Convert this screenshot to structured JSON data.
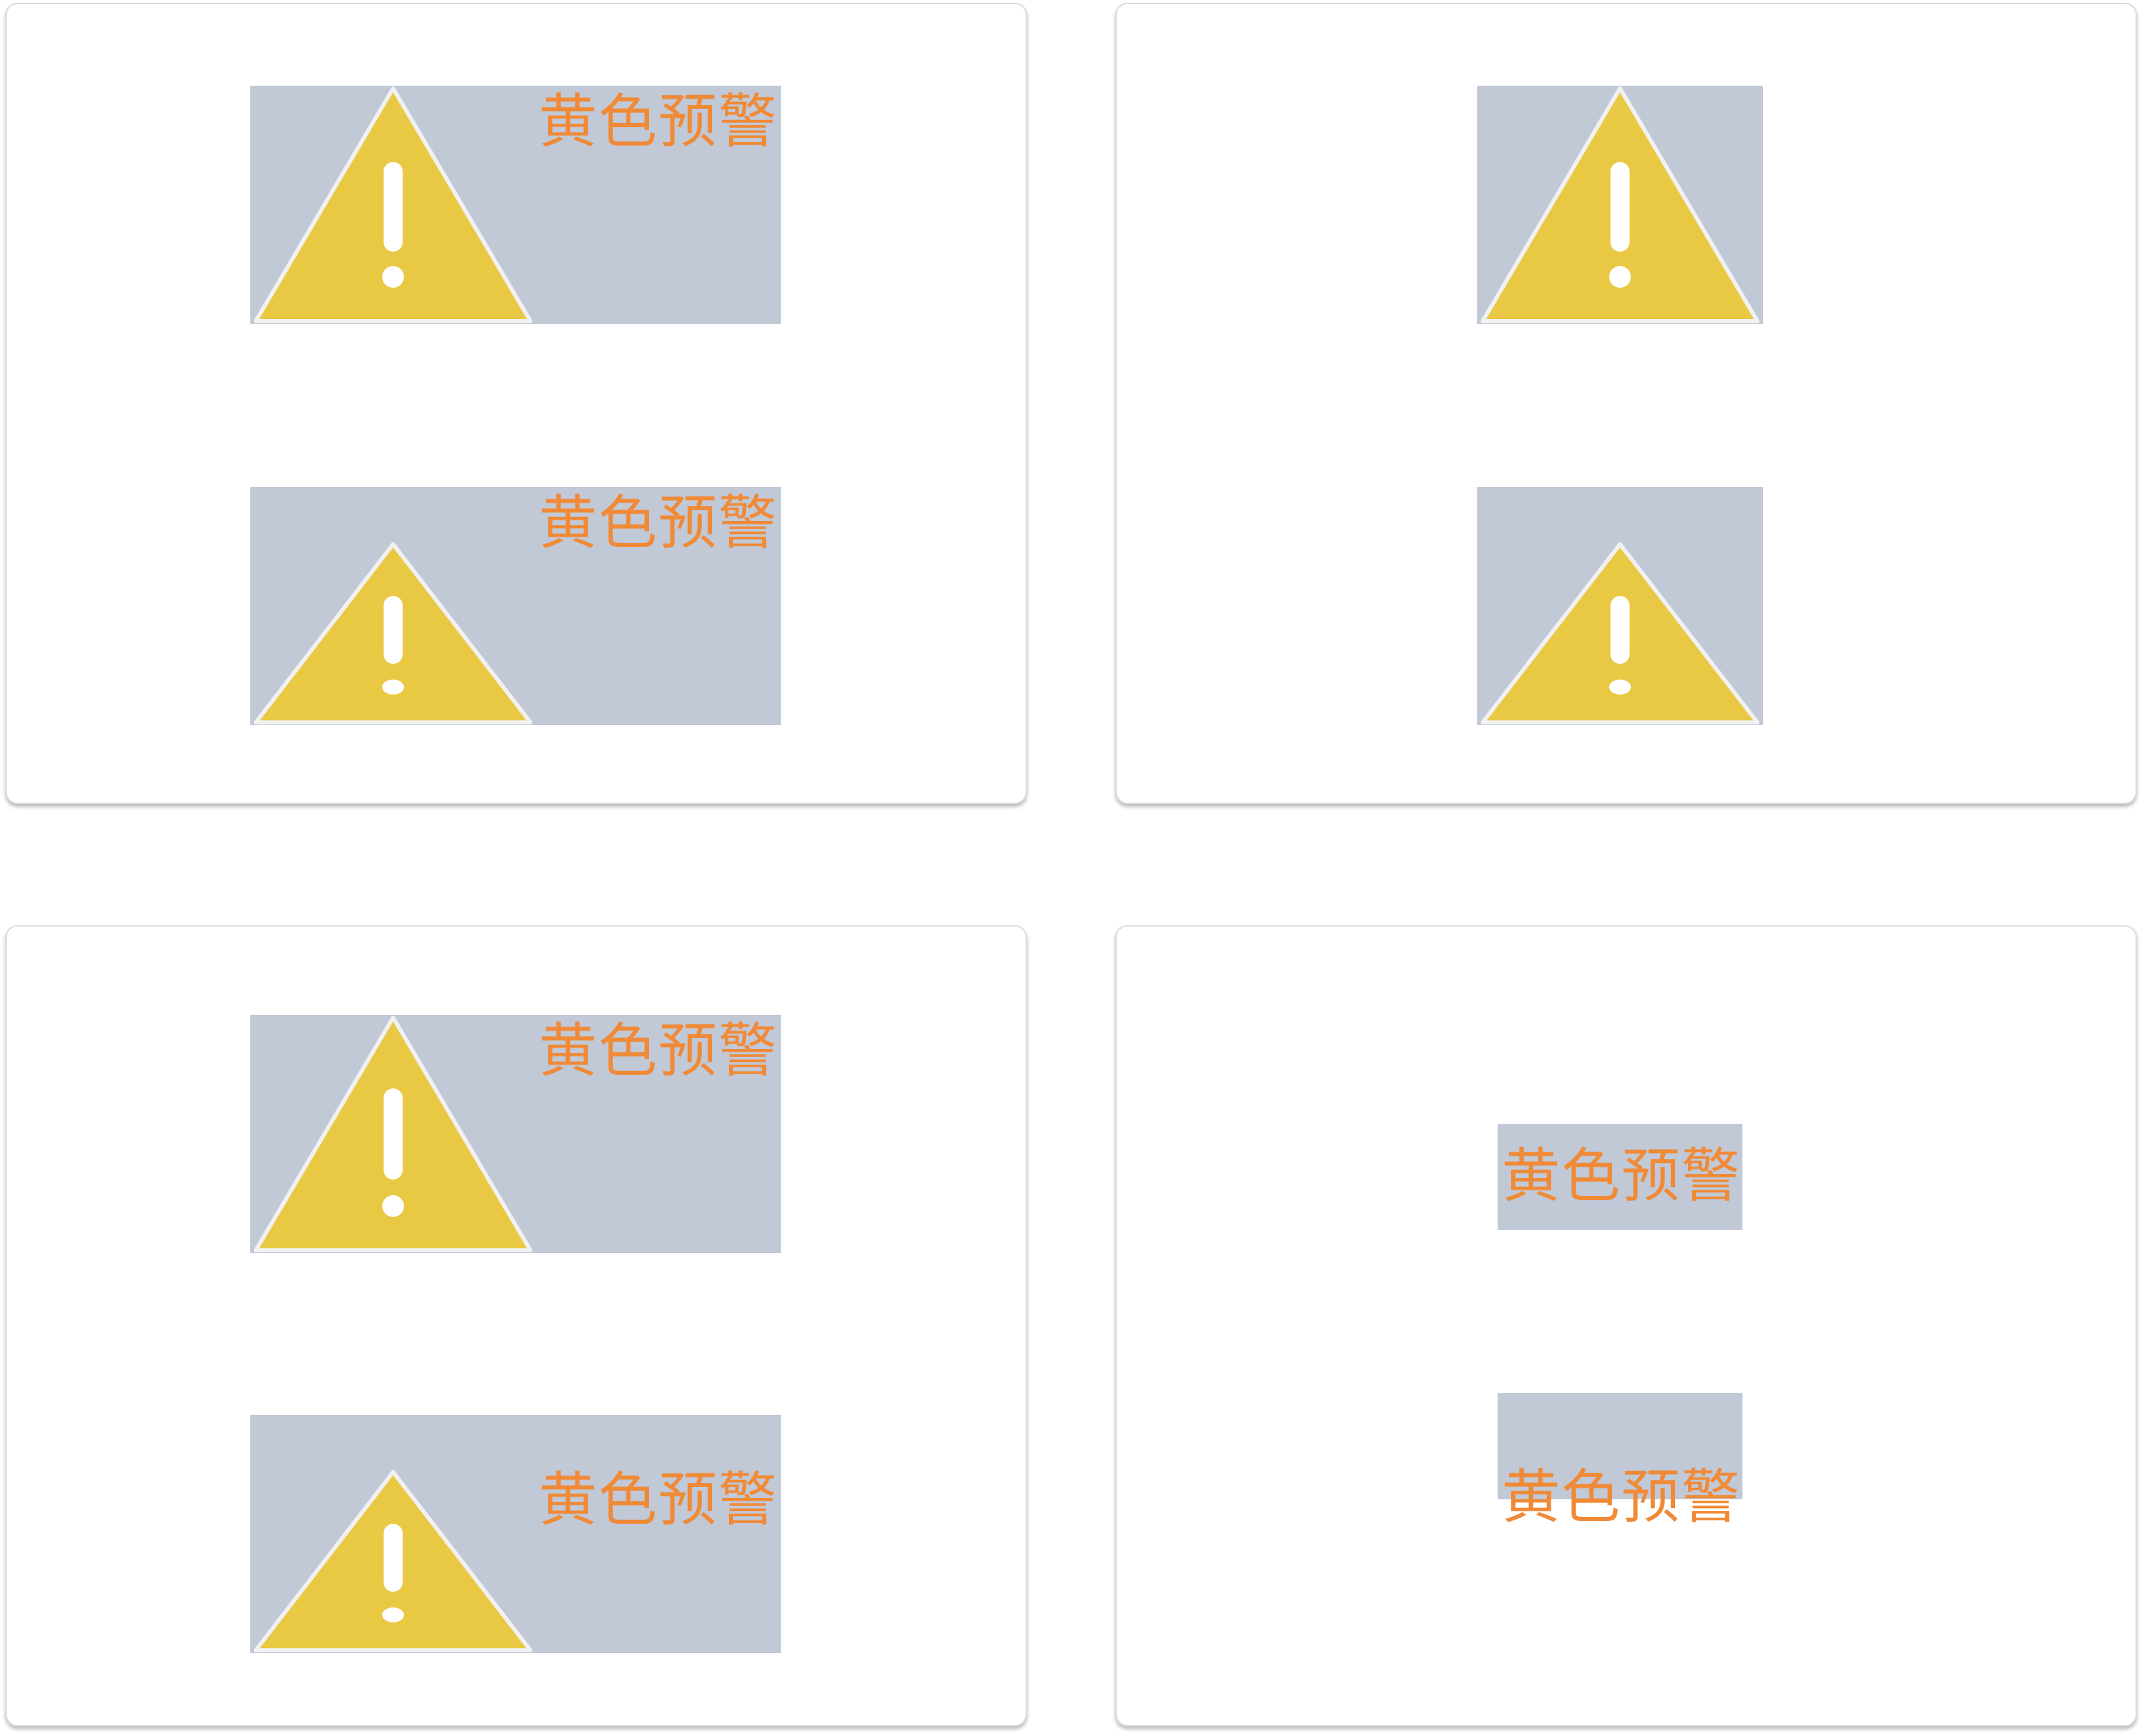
{
  "widgets": {
    "top_left": {
      "label_1": "黄色预警",
      "label_2": "黄色预警"
    },
    "bottom_left": {
      "label_1": "黄色预警",
      "label_2": "黄色预警"
    },
    "bottom_right": {
      "label_1": "黄色预警",
      "label_2": "黄色预警"
    }
  },
  "icons": {
    "warning": "warning-triangle-icon"
  },
  "colors": {
    "widget_background": "#c1c8d6",
    "triangle_fill": "#e9c843",
    "triangle_stroke": "#f1f1f1",
    "exclamation": "#ffffff",
    "label_text": "#f08a36",
    "card_background": "#ffffff"
  }
}
